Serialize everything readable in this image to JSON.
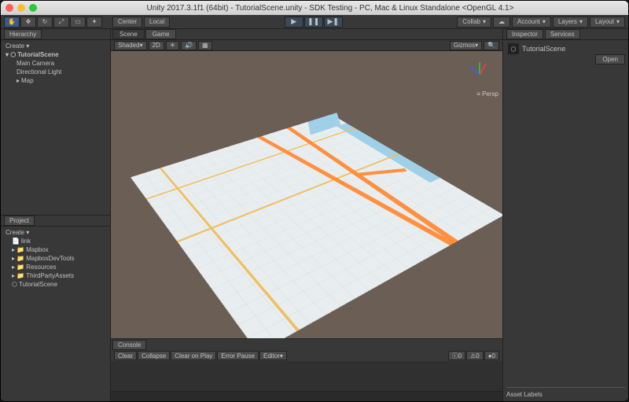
{
  "window": {
    "title": "Unity 2017.3.1f1 (64bit) - TutorialScene.unity - SDK Testing - PC, Mac & Linux Standalone <OpenGL 4.1>"
  },
  "toolbar": {
    "center_label": "Center",
    "local_label": "Local",
    "collab_label": "Collab",
    "account_label": "Account",
    "layers_label": "Layers",
    "layout_label": "Layout"
  },
  "hierarchy": {
    "tab_label": "Hierarchy",
    "create_label": "Create",
    "root": "TutorialScene",
    "items": [
      "Main Camera",
      "Directional Light",
      "Map"
    ]
  },
  "project": {
    "tab_label": "Project",
    "create_label": "Create",
    "items": [
      "link",
      "Mapbox",
      "MapboxDevTools",
      "Resources",
      "ThirdPartyAssets",
      "TutorialScene"
    ]
  },
  "scene": {
    "scene_tab": "Scene",
    "game_tab": "Game",
    "shaded_label": "Shaded",
    "mode_2d": "2D",
    "gizmos_label": "Gizmos",
    "persp_label": "Persp"
  },
  "console": {
    "tab_label": "Console",
    "clear": "Clear",
    "collapse": "Collapse",
    "clear_on_play": "Clear on Play",
    "error_pause": "Error Pause",
    "editor": "Editor",
    "info_count": "0",
    "warn_count": "0",
    "error_count": "0"
  },
  "inspector": {
    "inspector_tab": "Inspector",
    "services_tab": "Services",
    "scene_name": "TutorialScene",
    "open_label": "Open",
    "asset_labels": "Asset Labels"
  }
}
